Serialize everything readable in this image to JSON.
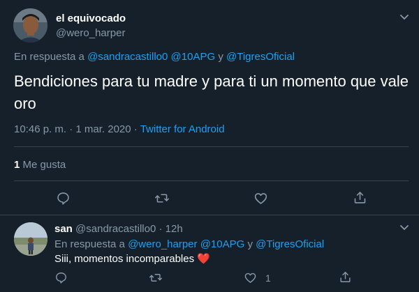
{
  "main_tweet": {
    "author_name": "el equivocado",
    "author_handle": "@wero_harper",
    "reply_prefix": "En respuesta a",
    "mentions": [
      "@sandracastillo0",
      "@10APG",
      "@TigresOficial"
    ],
    "mention_joiner": "y",
    "text": "Bendiciones para tu madre y para ti un momento que vale oro",
    "time": "10:46 p. m.",
    "separator": "·",
    "date": "1 mar. 2020",
    "source": "Twitter for Android",
    "likes_count": "1",
    "likes_label": "Me gusta",
    "actions": [
      "reply-icon",
      "retweet-icon",
      "like-icon",
      "share-icon"
    ]
  },
  "reply_tweet": {
    "author_name": "san",
    "author_handle": "@sandracastillo0",
    "separator": "·",
    "time_ago": "12h",
    "reply_prefix": "En respuesta a",
    "mentions": [
      "@wero_harper",
      "@10APG",
      "@TigresOficial"
    ],
    "mention_joiner": "y",
    "text": "Siii, momentos incomparables",
    "emoji": "❤️",
    "like_count": "1",
    "actions": [
      "reply-icon",
      "retweet-icon",
      "like-icon",
      "share-icon"
    ]
  },
  "colors": {
    "background": "#15202b",
    "primary_text": "#ffffff",
    "secondary_text": "#8899a6",
    "accent": "#1da1f2",
    "divider": "#38444d",
    "heart": "#e0245e"
  }
}
